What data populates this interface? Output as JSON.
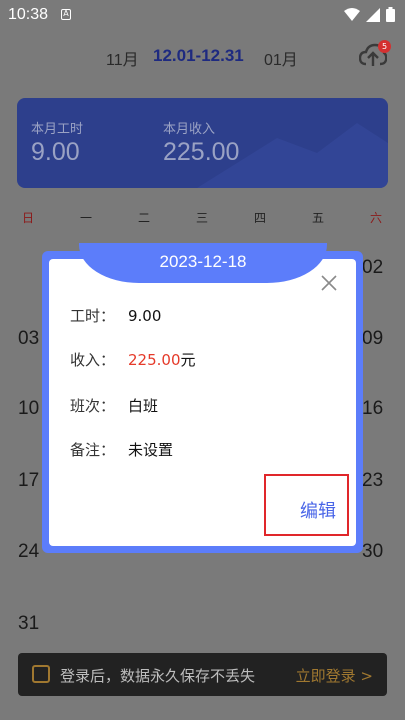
{
  "status_bar": {
    "time": "10:38",
    "a_icon": "A"
  },
  "month_nav": {
    "prev": "11月",
    "current": "12.01-12.31",
    "next": "01月"
  },
  "cloud_badge": "5",
  "summary": {
    "hours_label": "本月工时",
    "hours_value": "9.00",
    "income_label": "本月收入",
    "income_value": "225.00"
  },
  "weekdays": [
    "日",
    "一",
    "二",
    "三",
    "四",
    "五",
    "六"
  ],
  "calendar_dates": {
    "d02": "02",
    "d03": "03",
    "d09": "09",
    "d10": "10",
    "d16": "16",
    "d17": "17",
    "d23": "23",
    "d24": "24",
    "d30": "30",
    "d31": "31"
  },
  "dialog": {
    "date": "2023-12-18",
    "hours_label": "工时：",
    "hours_value": "9.00",
    "income_label": "收入：",
    "income_value": "225.00",
    "income_unit": "元",
    "shift_label": "班次：",
    "shift_value": "白班",
    "note_label": "备注：",
    "note_value": "未设置",
    "edit": "编辑"
  },
  "banner": {
    "text": "登录后，数据永久保存不丢失",
    "login": "立即登录 >"
  }
}
